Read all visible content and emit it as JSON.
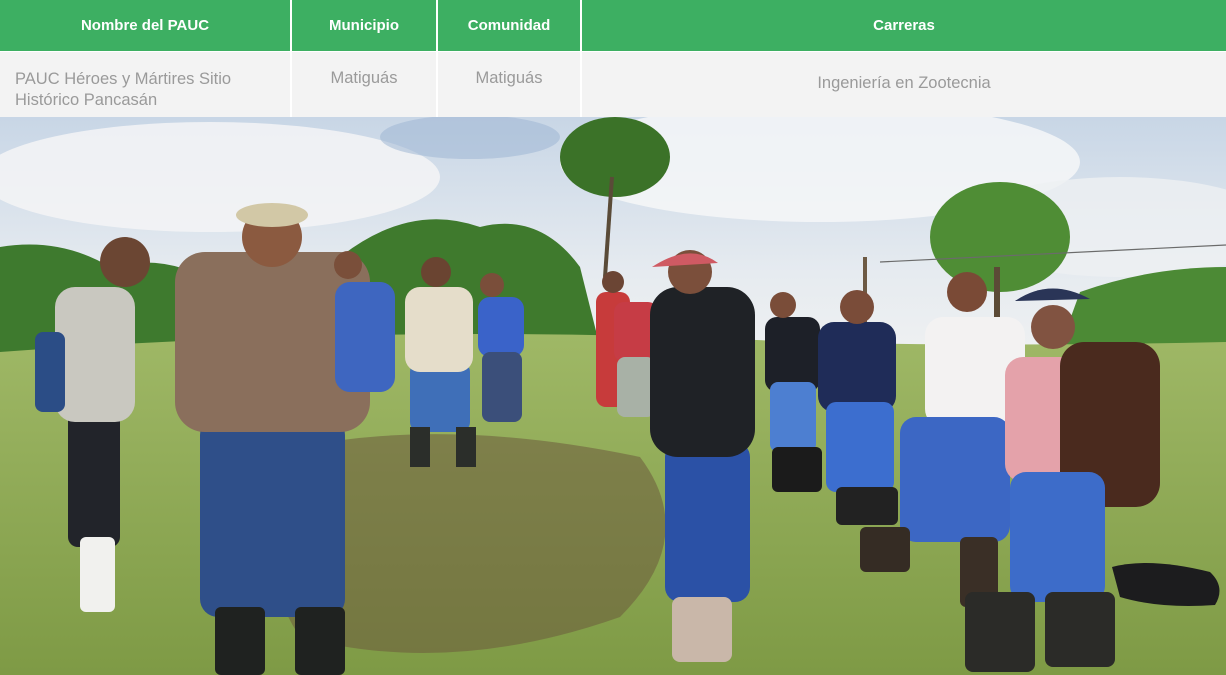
{
  "table": {
    "headers": [
      "Nombre del PAUC",
      "Municipio",
      "Comunidad",
      "Carreras"
    ],
    "row": {
      "nombre": "PAUC Héroes y Mártires Sitio Histórico Pancasán",
      "municipio": "Matiguás",
      "comunidad": "Matiguás",
      "carreras": "Ingeniería en Zootecnia"
    }
  },
  "colors": {
    "header_bg": "#3daf62",
    "header_text": "#ffffff",
    "cell_bg": "#f3f3f3",
    "cell_text": "#9a9a9a"
  }
}
